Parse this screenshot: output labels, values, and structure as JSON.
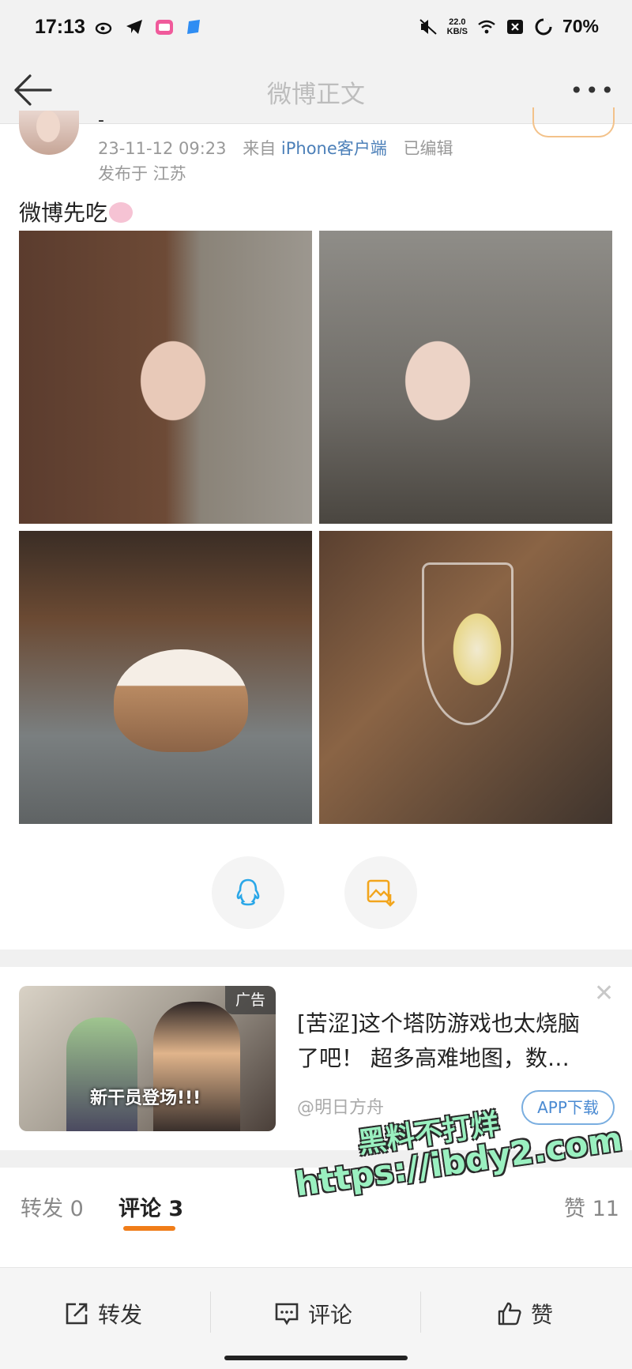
{
  "status_bar": {
    "time": "17:13",
    "net_speed_value": "22.0",
    "net_speed_unit": "KB/S",
    "battery": "70%",
    "icons": [
      "weibo-icon",
      "telegram-icon",
      "bilibili-icon",
      "app-icon",
      "mute-icon",
      "wifi-icon",
      "close-box-icon",
      "battery-icon"
    ]
  },
  "nav": {
    "title": "微博正文",
    "more": "•••"
  },
  "post": {
    "author_mark": "-",
    "timestamp": "23-11-12 09:23",
    "source_prefix": "来自",
    "source": "iPhone客户端",
    "edited": "已编辑",
    "location": "发布于 江苏",
    "text": "微博先吃",
    "images": [
      "photo-1",
      "photo-2",
      "photo-3",
      "photo-4"
    ]
  },
  "ad": {
    "badge": "广告",
    "image_caption": "新干员登场!!!",
    "title": "[苦涩]这个塔防游戏也太烧脑了吧！ 超多高难地图，数…",
    "account": "@明日方舟",
    "download": "APP下载",
    "close": "✕"
  },
  "watermark": {
    "line1": "黑料不打烊",
    "line2": "https://ibdy2.com"
  },
  "tabs": {
    "repost": "转发 0",
    "comment": "评论 3",
    "like": "赞 11"
  },
  "bottom_bar": {
    "repost": "转发",
    "comment": "评论",
    "like": "赞"
  },
  "colors": {
    "accent_orange": "#f07d19",
    "link_blue": "#4b7fb8",
    "share_blue": "#2aa7e8",
    "save_orange": "#f2a51c"
  }
}
